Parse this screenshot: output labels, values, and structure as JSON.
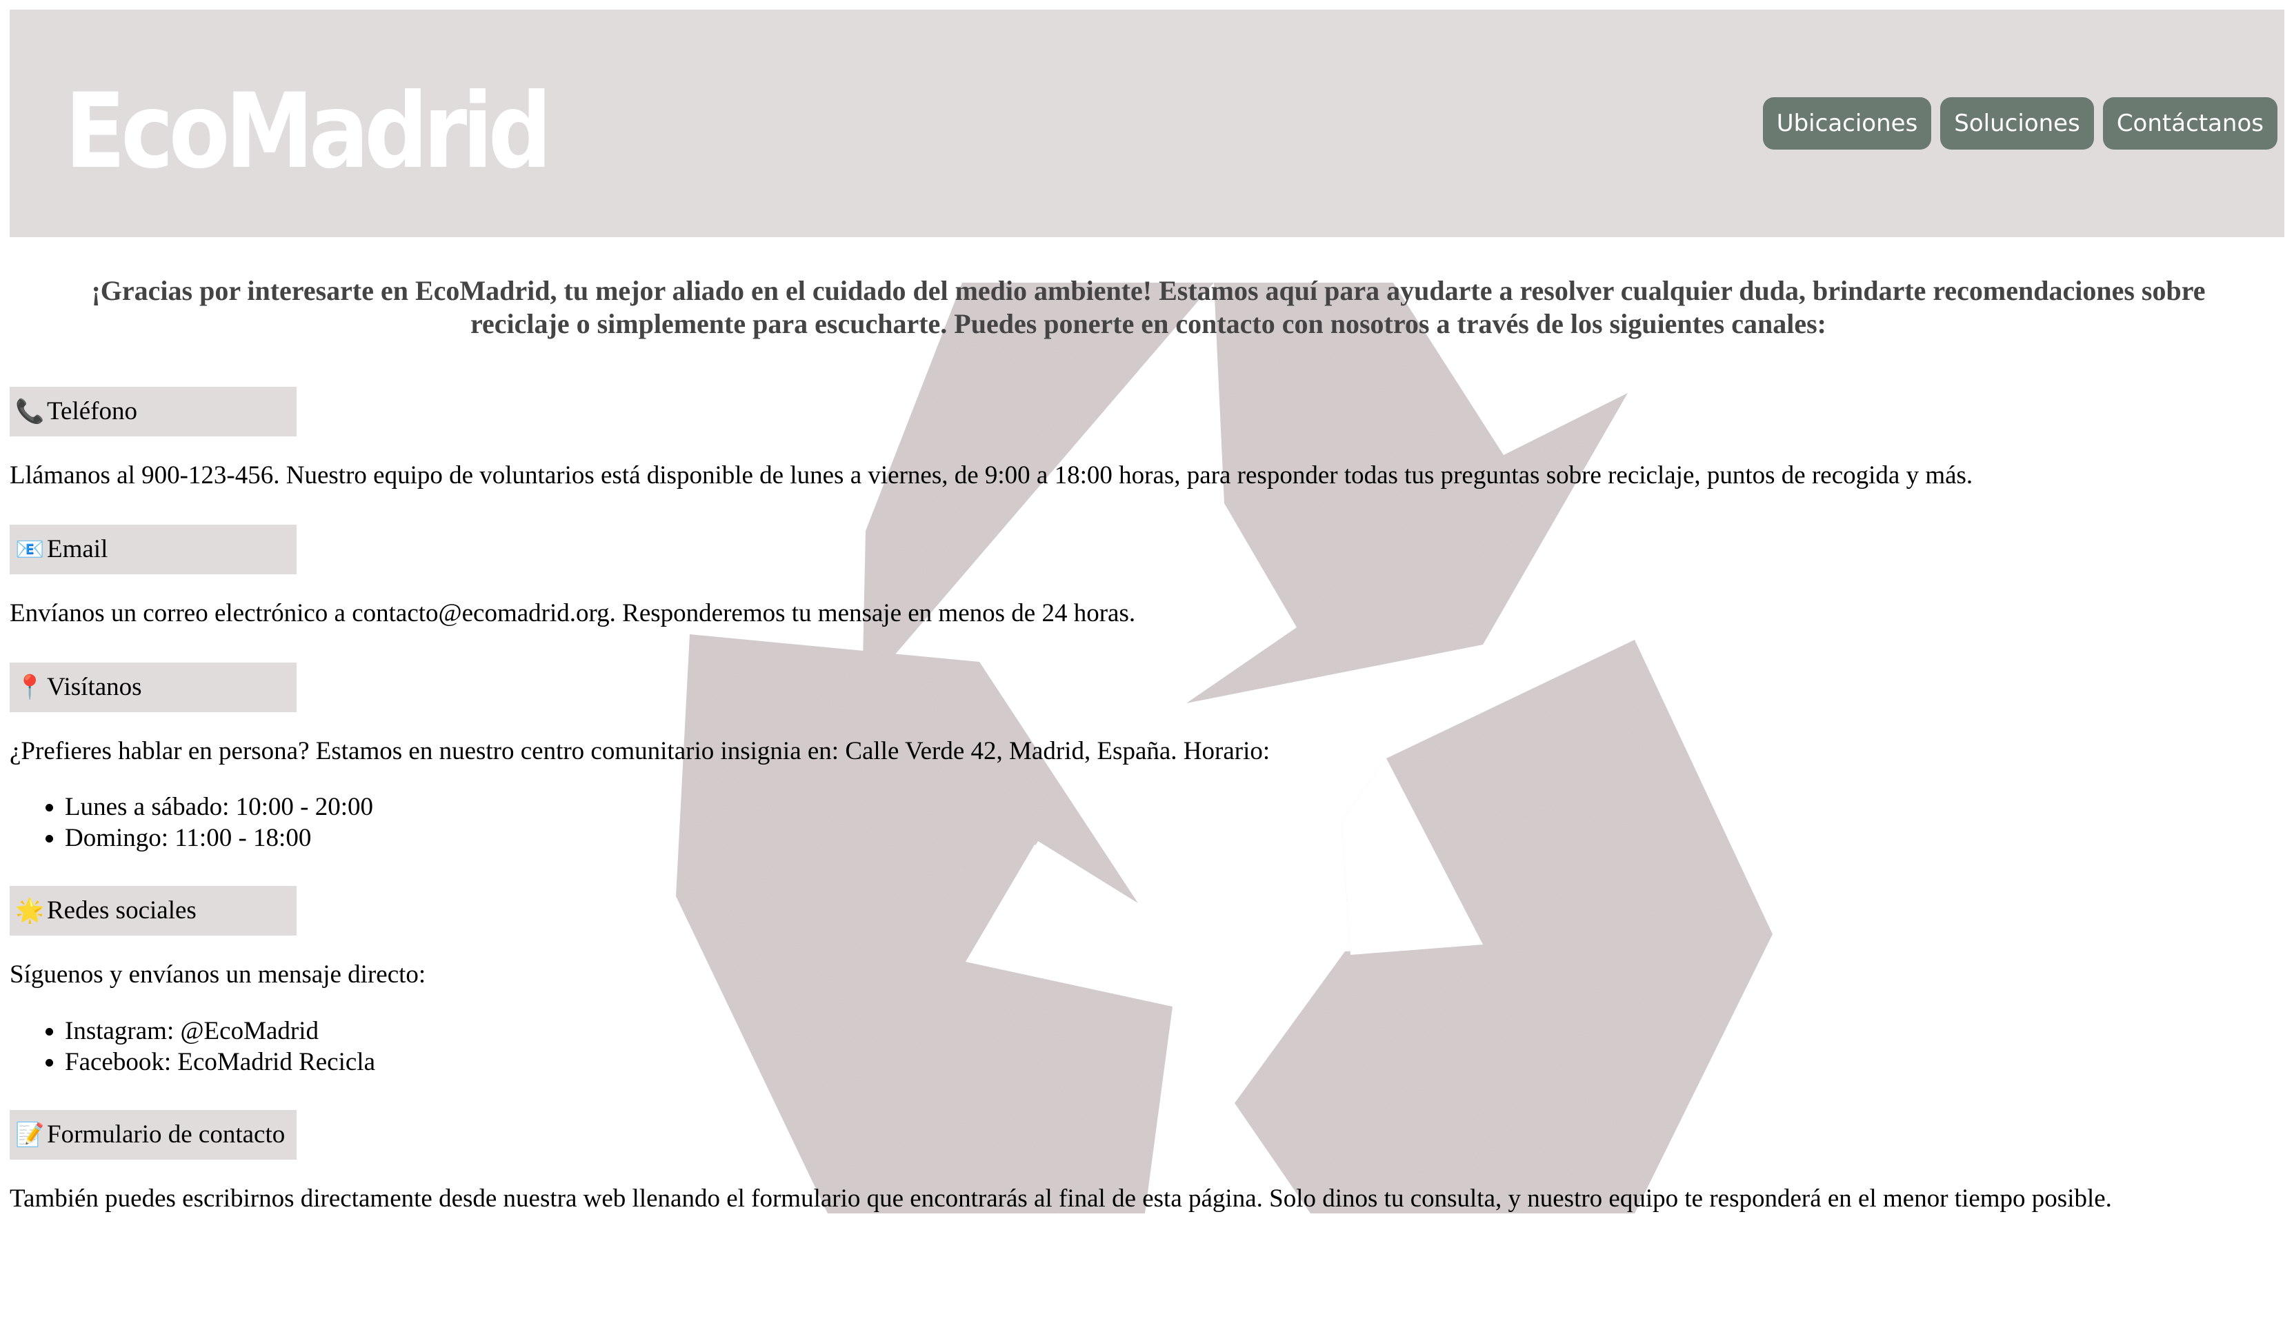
{
  "header": {
    "logo": "EcoMadrid",
    "nav": [
      "Ubicaciones",
      "Soluciones",
      "Contáctanos"
    ]
  },
  "intro": "¡Gracias por interesarte en EcoMadrid, tu mejor aliado en el cuidado del medio ambiente! Estamos aquí para ayudarte a resolver cualquier duda, brindarte recomendaciones sobre reciclaje o simplemente para escucharte. Puedes ponerte en contacto con nosotros a través de los siguientes canales:",
  "sections": {
    "phone": {
      "icon": "📞",
      "label": "Teléfono",
      "text": "Llámanos al 900-123-456. Nuestro equipo de voluntarios está disponible de lunes a viernes, de 9:00 a 18:00 horas, para responder todas tus preguntas sobre reciclaje, puntos de recogida y más."
    },
    "email": {
      "icon": "📧",
      "label": "Email",
      "text": "Envíanos un correo electrónico a contacto@ecomadrid.org. Responderemos tu mensaje en menos de 24 horas."
    },
    "visit": {
      "icon": "📍",
      "label": "Visítanos",
      "text": "¿Prefieres hablar en persona? Estamos en nuestro centro comunitario insignia en: Calle Verde 42, Madrid, España. Horario:",
      "hours": [
        "Lunes a sábado: 10:00 - 20:00",
        "Domingo: 11:00 - 18:00"
      ]
    },
    "social": {
      "icon": "🌟",
      "label": "Redes sociales",
      "text": "Síguenos y envíanos un mensaje directo:",
      "items": [
        "Instagram: @EcoMadrid",
        "Facebook: EcoMadrid Recicla"
      ]
    },
    "form": {
      "icon": "📝",
      "label": "Formulario de contacto",
      "text": "También puedes escribirnos directamente desde nuestra web llenando el formulario que encontrarás al final de esta página. Solo dinos tu consulta, y nuestro equipo te responderá en el menor tiempo posible."
    }
  },
  "colors": {
    "header_bg": "#e1dcdc",
    "nav_button_bg": "#6b7a70",
    "intro_text": "#444444",
    "recycle_paper": "#d3cbcb"
  }
}
